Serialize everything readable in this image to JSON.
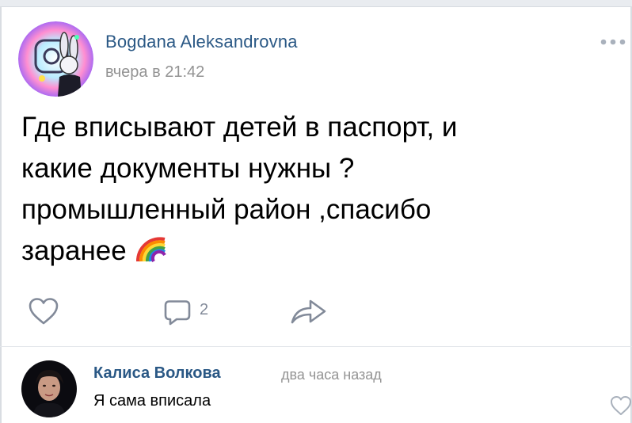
{
  "post": {
    "author": "Bogdana Aleksandrovna",
    "time": "вчера в 21:42",
    "text_lines": [
      "Где вписывают детей в паспорт, и",
      "какие документы нужны ?",
      "промышленный район ,спасибо",
      "заранее"
    ],
    "emoji": "rainbow",
    "comment_count": "2"
  },
  "icons": {
    "more": "more-horizontal-icon",
    "like": "heart-icon",
    "comment": "comment-icon",
    "share": "share-arrow-icon",
    "comment_like": "heart-icon"
  },
  "comment": {
    "author": "Калиса Волкова",
    "time": "два часа назад",
    "text": "Я сама вписала"
  },
  "colors": {
    "link": "#2a5885",
    "muted": "#939393",
    "icon": "#828a99"
  }
}
